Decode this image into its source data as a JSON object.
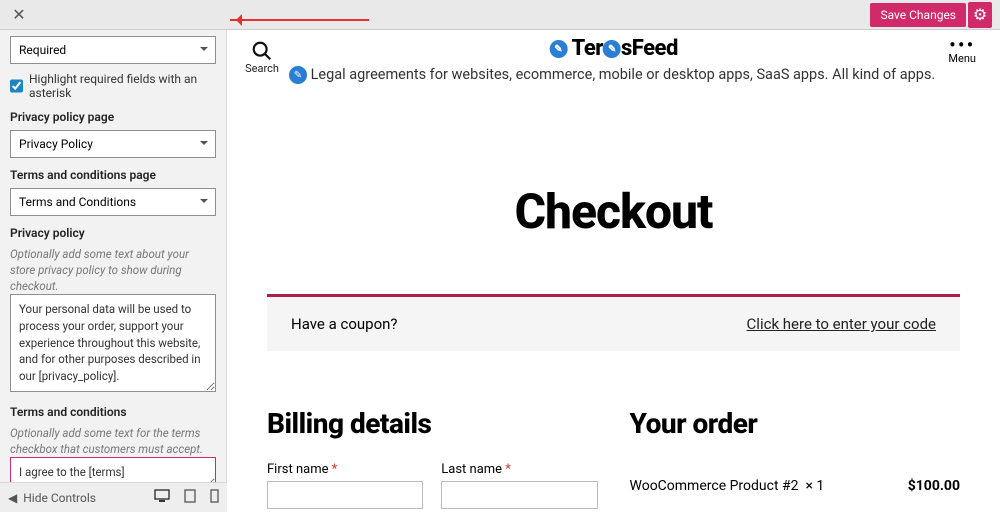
{
  "topbar": {
    "save": "Save Changes"
  },
  "panel": {
    "phone_sel": "Required",
    "highlight": "Highlight required fields with an asterisk",
    "priv_page_lbl": "Privacy policy page",
    "priv_page_sel": "Privacy Policy",
    "terms_page_lbl": "Terms and conditions page",
    "terms_page_sel": "Terms and Conditions",
    "priv_lbl": "Privacy policy",
    "priv_hint": "Optionally add some text about your store privacy policy to show during checkout.",
    "priv_txt": "Your personal data will be used to process your order, support your experience throughout this website, and for other purposes described in our [privacy_policy].",
    "terms_lbl": "Terms and conditions",
    "terms_hint": "Optionally add some text for the terms checkbox that customers must accept.",
    "terms_txt": "I agree to the [terms]"
  },
  "footer": {
    "hide": "Hide Controls"
  },
  "preview": {
    "search": "Search",
    "brand1": "Ter",
    "brand2": "sFeed",
    "tagline": "Legal agreements for websites, ecommerce, mobile or desktop apps, SaaS apps. All kind of apps.",
    "menu": "Menu",
    "h1": "Checkout",
    "coupon_q": "Have a coupon?",
    "coupon_a": "Click here to enter your code",
    "billing": "Billing details",
    "order": "Your order",
    "first": "First name",
    "last": "Last name",
    "prod": "WooCommerce Product #2",
    "qty": "× 1",
    "price": "$100.00"
  }
}
